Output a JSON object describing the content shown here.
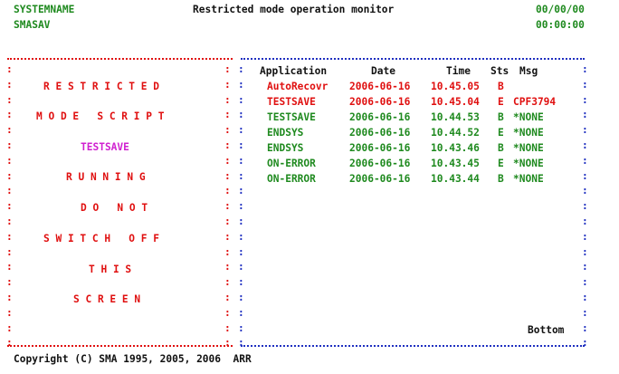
{
  "colors": {
    "header": "#1f8a1f",
    "title": "#111111",
    "border": "#e01010",
    "status_text": "#e01010",
    "script_name": "#d020d0",
    "ok_row": "#1f8a1f",
    "active_row": "#e01010"
  },
  "header": {
    "system_name": "SYSTEMNAME",
    "program": "SMASAV",
    "title": "Restricted mode operation monitor",
    "date": "00/00/00",
    "time": "00:00:00"
  },
  "left_panel": {
    "line1": "R E S T R I C T E D",
    "line2": "M O D E   S C R I P T",
    "script_name": "TESTSAVE",
    "line3": "R U N N I N G",
    "line4": "D O   N O T",
    "line5": "S W I T C H   O F F",
    "line6": "T H I S",
    "line7": "S C R E E N"
  },
  "table": {
    "headers": {
      "application": "Application",
      "date": "Date",
      "time": "Time",
      "sts": "Sts",
      "msg": "Msg"
    },
    "rows": [
      {
        "application": "AutoRecovr",
        "date": "2006-06-16",
        "time": "10.45.05",
        "sts": "B",
        "msg": "",
        "color": "red"
      },
      {
        "application": "TESTSAVE",
        "date": "2006-06-16",
        "time": "10.45.04",
        "sts": "E",
        "msg": "CPF3794",
        "color": "red"
      },
      {
        "application": "TESTSAVE",
        "date": "2006-06-16",
        "time": "10.44.53",
        "sts": "B",
        "msg": "*NONE",
        "color": "green"
      },
      {
        "application": "ENDSYS",
        "date": "2006-06-16",
        "time": "10.44.52",
        "sts": "E",
        "msg": "*NONE",
        "color": "green"
      },
      {
        "application": "ENDSYS",
        "date": "2006-06-16",
        "time": "10.43.46",
        "sts": "B",
        "msg": "*NONE",
        "color": "green"
      },
      {
        "application": "ON-ERROR",
        "date": "2006-06-16",
        "time": "10.43.45",
        "sts": "E",
        "msg": "*NONE",
        "color": "green"
      },
      {
        "application": "ON-ERROR",
        "date": "2006-06-16",
        "time": "10.43.44",
        "sts": "B",
        "msg": "*NONE",
        "color": "green"
      }
    ],
    "scroll_indicator": "Bottom"
  },
  "footer": {
    "copyright": "Copyright (C) SMA 1995, 2005, 2006  ARR"
  }
}
